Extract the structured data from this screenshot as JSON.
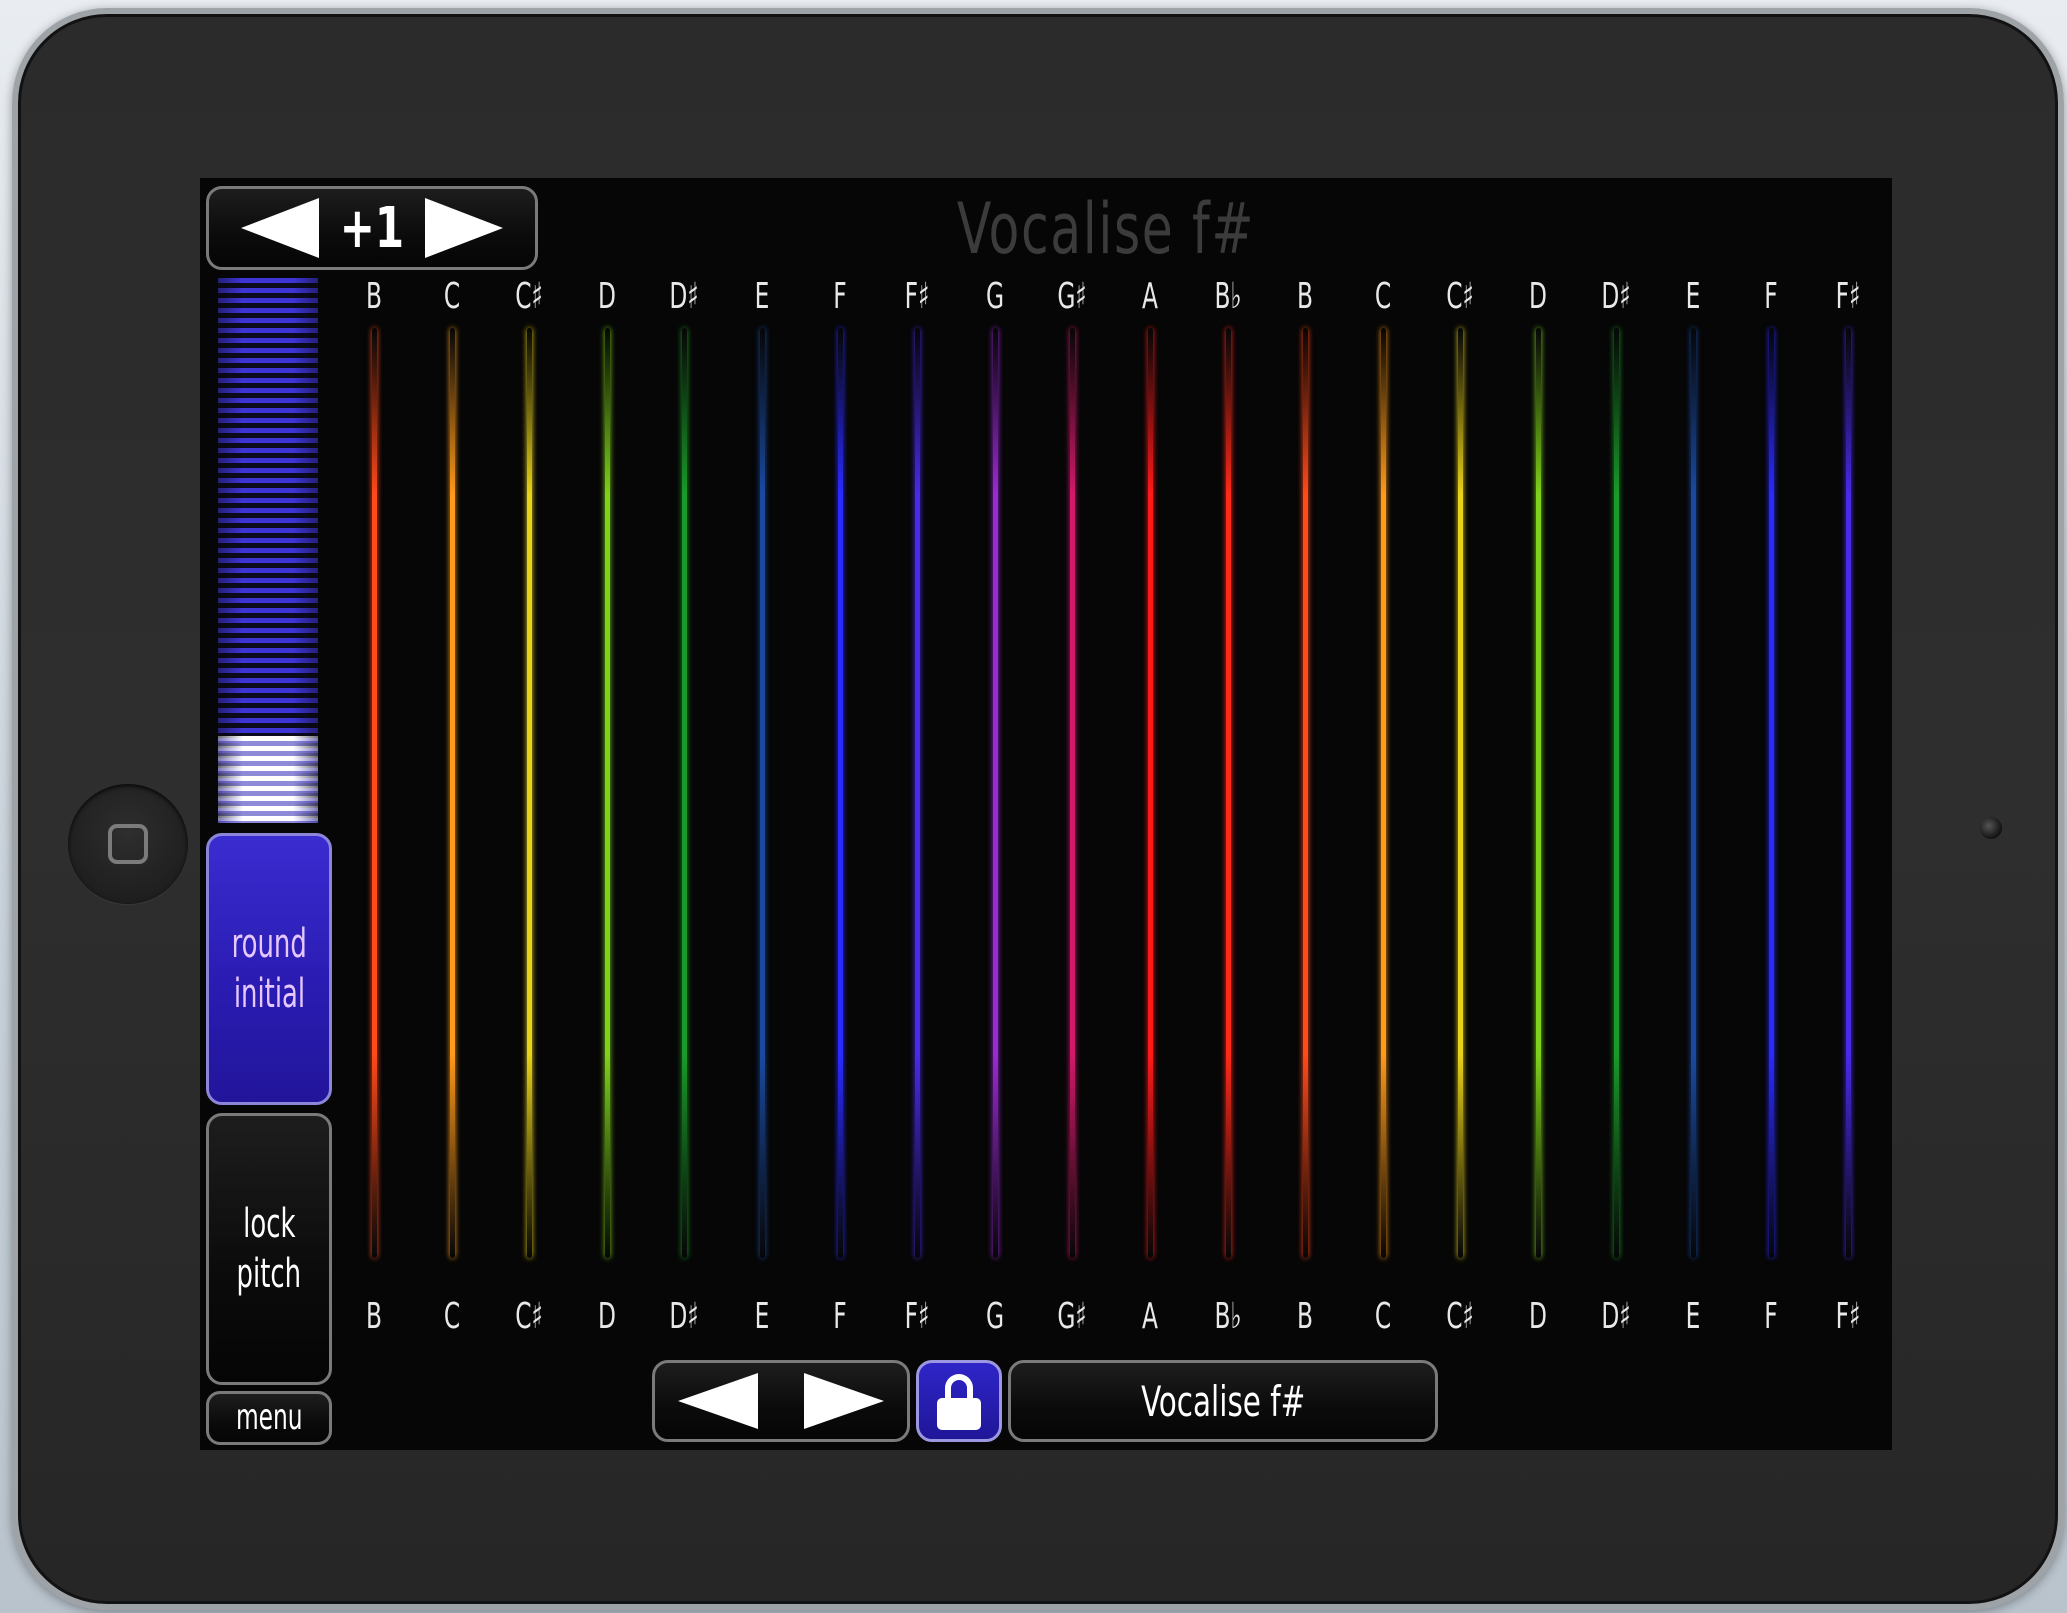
{
  "header": {
    "title": "Vocalise f#",
    "octave_value": "+1"
  },
  "sidebar": {
    "round_initial_line1": "round",
    "round_initial_line2": "initial",
    "lock_pitch_line1": "lock",
    "lock_pitch_line2": "pitch",
    "menu_label": "menu",
    "level_meter": {
      "level": 0.16
    }
  },
  "bottom_bar": {
    "preset_label": "Vocalise f#",
    "lock_active": true
  },
  "notes": [
    {
      "name": "B",
      "color": "#ff4a1a"
    },
    {
      "name": "C",
      "color": "#ff9a1a"
    },
    {
      "name": "C♯",
      "color": "#e8d21a"
    },
    {
      "name": "D",
      "color": "#7fd21a"
    },
    {
      "name": "D♯",
      "color": "#1a9a2a"
    },
    {
      "name": "E",
      "color": "#1a4aa0"
    },
    {
      "name": "F",
      "color": "#2a2aff"
    },
    {
      "name": "F♯",
      "color": "#4a2ae8"
    },
    {
      "name": "G",
      "color": "#9a2ad2"
    },
    {
      "name": "G♯",
      "color": "#d21a6a"
    },
    {
      "name": "A",
      "color": "#ff1a1a"
    },
    {
      "name": "B♭",
      "color": "#ff2a1a"
    },
    {
      "name": "B",
      "color": "#ff4a1a"
    },
    {
      "name": "C",
      "color": "#ff9a1a"
    },
    {
      "name": "C♯",
      "color": "#e8d21a"
    },
    {
      "name": "D",
      "color": "#7fd21a"
    },
    {
      "name": "D♯",
      "color": "#1a9a2a"
    },
    {
      "name": "E",
      "color": "#1a4aa0"
    },
    {
      "name": "F",
      "color": "#2a2aff"
    },
    {
      "name": "F♯",
      "color": "#4a2ae8"
    }
  ],
  "icons": {
    "octave_down": "left-triangle-icon",
    "octave_up": "right-triangle-icon",
    "prev_preset": "left-triangle-icon",
    "next_preset": "right-triangle-icon",
    "lock": "padlock-icon",
    "home": "home-button-icon"
  },
  "colors": {
    "accent": "#2f25c8",
    "screen_bg": "#060606",
    "title_color": "#3b3b3b"
  }
}
